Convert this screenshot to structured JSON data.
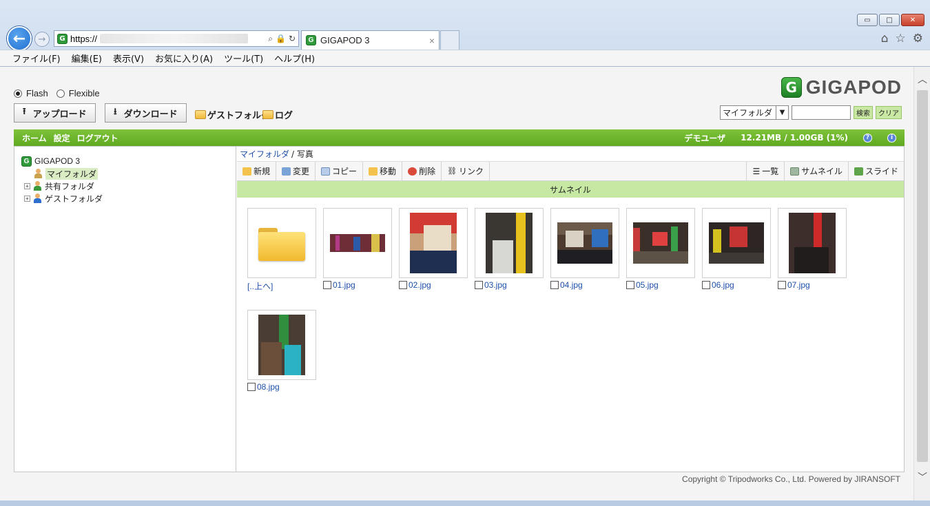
{
  "browser": {
    "url_prefix": "https://",
    "tab_title": "GIGAPOD 3",
    "tab_close": "×",
    "window_buttons": [
      "▭",
      "□",
      "✕"
    ],
    "menu": [
      "ファイル(F)",
      "編集(E)",
      "表示(V)",
      "お気に入り(A)",
      "ツール(T)",
      "ヘルプ(H)"
    ]
  },
  "app": {
    "brand": "GIGAPOD",
    "brand_mark": "G",
    "mode_flash": "Flash",
    "mode_flexible": "Flexible",
    "upload_label": "アップロード",
    "download_label": "ダウンロード",
    "guest_folder_link": "ゲストフォルダ",
    "log_link": "ログ",
    "folder_select_value": "マイフォルダ",
    "search_button": "検索",
    "clear_button": "クリア",
    "nav": {
      "home": "ホーム",
      "settings": "設定",
      "logout": "ログアウト"
    },
    "user": "デモユーザ",
    "quota": "12.21MB / 1.00GB (1%)"
  },
  "tree": {
    "root": "GIGAPOD 3",
    "items": [
      "マイフォルダ",
      "共有フォルダ",
      "ゲストフォルダ"
    ]
  },
  "main": {
    "breadcrumb_link": "マイフォルダ",
    "breadcrumb_current": "/ 写真",
    "toolbar": [
      "新規",
      "変更",
      "コピー",
      "移動",
      "削除",
      "リンク"
    ],
    "views": [
      "一覧",
      "サムネイル",
      "スライド"
    ],
    "view_title": "サムネイル",
    "up_label": "[..上へ]",
    "files": [
      "01.jpg",
      "02.jpg",
      "03.jpg",
      "04.jpg",
      "05.jpg",
      "06.jpg",
      "07.jpg",
      "08.jpg"
    ]
  },
  "footer": "Copyright © Tripodworks Co., Ltd. Powered by JIRANSOFT"
}
